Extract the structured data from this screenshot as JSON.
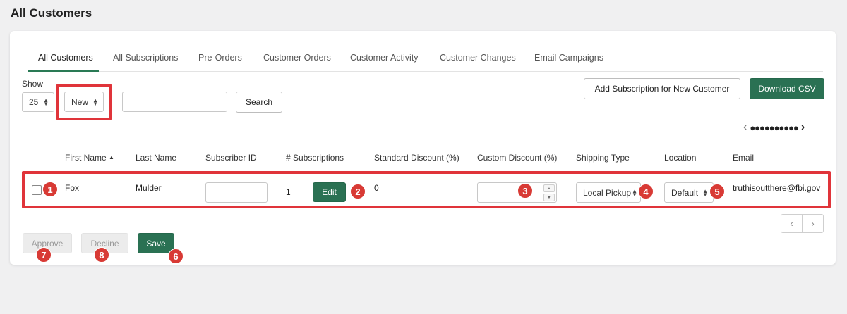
{
  "page": {
    "title": "All Customers"
  },
  "tabs": [
    {
      "label": "All Customers"
    },
    {
      "label": "All Subscriptions"
    },
    {
      "label": "Pre-Orders"
    },
    {
      "label": "Customer Orders"
    },
    {
      "label": "Customer Activity"
    },
    {
      "label": "Customer Changes"
    },
    {
      "label": "Email Campaigns"
    }
  ],
  "controls": {
    "show_label": "Show",
    "show_value": "25",
    "status_value": "New",
    "search_placeholder": "",
    "search_button": "Search",
    "add_subscription_button": "Add Subscription for New Customer",
    "download_csv_button": "Download CSV"
  },
  "pager": {
    "dots": "●●●●●●●●●●",
    "prev": "‹",
    "next": "›"
  },
  "table": {
    "headers": {
      "first_name": "First Name",
      "last_name": "Last Name",
      "subscriber_id": "Subscriber ID",
      "subscriptions": "# Subscriptions",
      "standard_discount": "Standard Discount (%)",
      "custom_discount": "Custom Discount (%)",
      "shipping_type": "Shipping Type",
      "location": "Location",
      "email": "Email"
    },
    "sort_icon": "▲",
    "rows": [
      {
        "first_name": "Fox",
        "last_name": "Mulder",
        "subscriber_id": "",
        "subscriptions": "1",
        "edit_label": "Edit",
        "standard_discount": "0",
        "custom_discount": "",
        "shipping_type": "Local Pickup",
        "location": "Default",
        "email": "truthisoutthere@fbi.gov"
      }
    ]
  },
  "actions": {
    "approve": "Approve",
    "decline": "Decline",
    "save": "Save"
  },
  "badges": {
    "b1": "1",
    "b2": "2",
    "b3": "3",
    "b4": "4",
    "b5": "5",
    "b6": "6",
    "b7": "7",
    "b8": "8"
  },
  "colors": {
    "accent": "#2a7153",
    "highlight": "#e0343a",
    "badge": "#d83a35"
  },
  "icons": {
    "select": "up-down-arrows-icon",
    "chevron_left": "chevron-left-icon",
    "chevron_right": "chevron-right-icon"
  }
}
